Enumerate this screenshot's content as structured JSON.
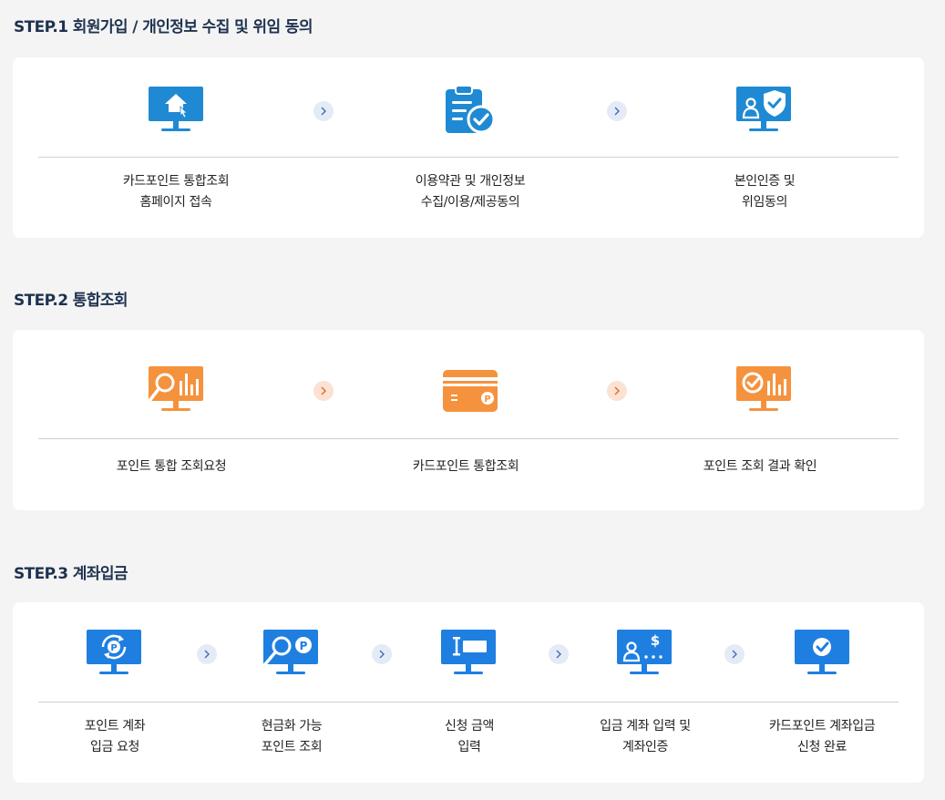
{
  "colors": {
    "background": "#f4f4f4",
    "card": "#ffffff",
    "title": "#1e3250",
    "icon_blue": "#1f8ad3",
    "icon_blue_bright": "#1f7fe0",
    "icon_orange": "#f5923e",
    "arrow_blue_bg": "#e4ebf7",
    "arrow_orange_bg": "#fbe2d3"
  },
  "step1": {
    "title": "STEP.1 회원가입 / 개인정보 수집 및 위임 동의",
    "items": [
      {
        "icon": "monitor-home-icon",
        "line1": "카드포인트 통합조회",
        "line2": "홈페이지 접속"
      },
      {
        "icon": "clipboard-check-icon",
        "line1": "이용약관 및 개인정보",
        "line2": "수집/이용/제공동의"
      },
      {
        "icon": "monitor-user-shield-icon",
        "line1": "본인인증 및",
        "line2": "위임동의"
      }
    ]
  },
  "step2": {
    "title": "STEP.2 통합조회",
    "items": [
      {
        "icon": "monitor-search-chart-icon",
        "line1": "포인트 통합 조회요청"
      },
      {
        "icon": "point-card-icon",
        "line1": "카드포인트 통합조회"
      },
      {
        "icon": "monitor-check-chart-icon",
        "line1": "포인트 조회 결과 확인"
      }
    ]
  },
  "step3": {
    "title": "STEP.3 계좌입금",
    "items": [
      {
        "icon": "monitor-point-refresh-icon",
        "line1": "포인트 계좌",
        "line2": "입금 요청"
      },
      {
        "icon": "monitor-search-point-icon",
        "line1": "현금화 가능",
        "line2": "포인트 조회"
      },
      {
        "icon": "monitor-input-icon",
        "line1": "신청 금액",
        "line2": "입력"
      },
      {
        "icon": "monitor-user-dollar-icon",
        "line1": "입금 계좌 입력 및",
        "line2": "계좌인증"
      },
      {
        "icon": "monitor-check-icon",
        "line1": "카드포인트 계좌입금",
        "line2": "신청 완료"
      }
    ]
  }
}
